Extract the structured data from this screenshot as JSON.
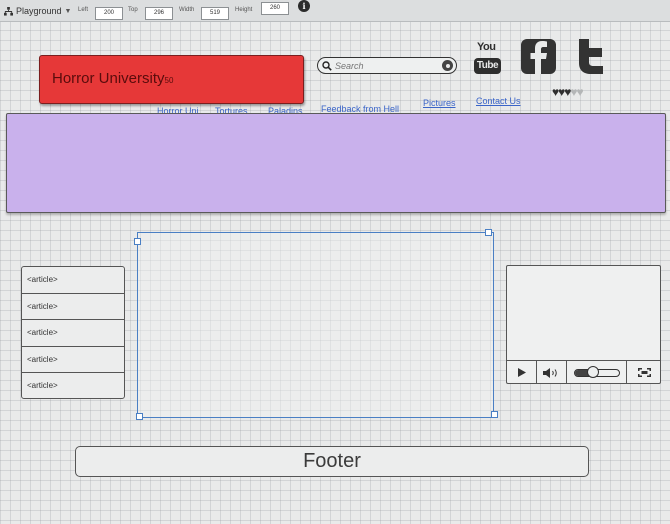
{
  "toolbar": {
    "app_name": "Playground",
    "left_label": "Left",
    "left_value": "200",
    "top_label": "Top",
    "top_value": "296",
    "width_label": "Width",
    "width_value": "519",
    "height_label": "Height",
    "height_value": "260",
    "info_glyph": "i"
  },
  "header": {
    "brand_title": "Horror University",
    "brand_suffix": "50",
    "search_placeholder": "Search",
    "youtube_top": "You",
    "youtube_bottom": "Tube"
  },
  "rating": {
    "filled": 3,
    "total": 5
  },
  "favorites": {
    "filled": 3,
    "total": 5
  },
  "nav": [
    {
      "label": "Horror Uni"
    },
    {
      "label": "Tortures"
    },
    {
      "label": "Paladins"
    },
    {
      "label": "Feedback from Hell"
    },
    {
      "label": "Pictures"
    },
    {
      "label": "Contact Us"
    }
  ],
  "articles": [
    "<article>",
    "<article>",
    "<article>",
    "<article>",
    "<article>"
  ],
  "video": {
    "volume_level": 0.4
  },
  "footer": {
    "label": "Footer"
  },
  "colors": {
    "brand_fill": "#e63838",
    "banner_fill": "#c9b1ec",
    "link": "#3a64c8",
    "selection": "#4a7fc4"
  }
}
